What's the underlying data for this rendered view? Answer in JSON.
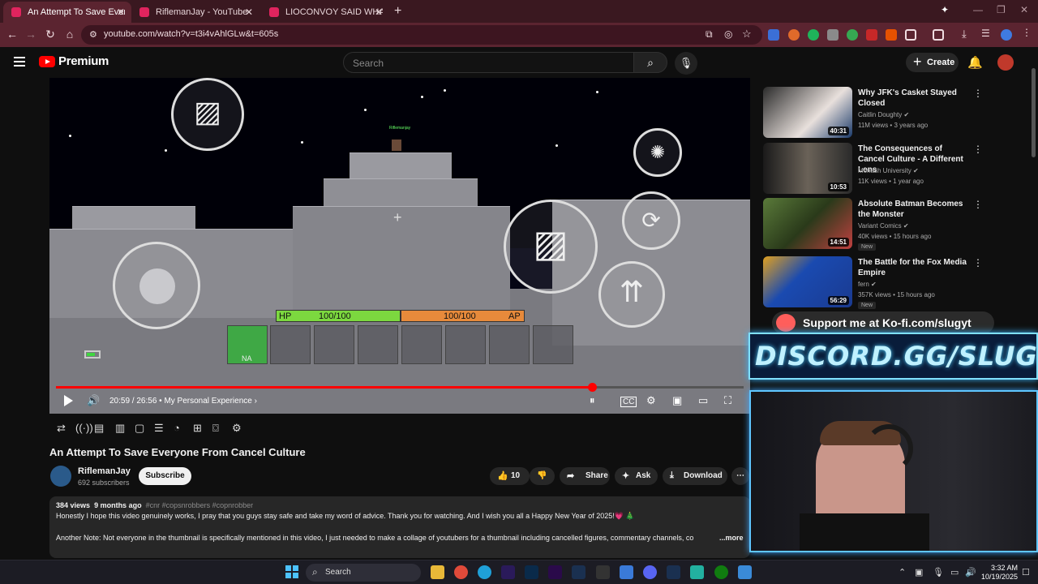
{
  "browser": {
    "tabs": [
      {
        "title": "An Attempt To Save Everyone F",
        "active": true
      },
      {
        "title": "RiflemanJay - YouTube",
        "active": false
      },
      {
        "title": "LIOCONVOY SAID WHAT?! | Rif",
        "active": false
      }
    ],
    "url": "youtube.com/watch?v=t3i4vAhlGLw&t=605s"
  },
  "header": {
    "logo_text": "Premium",
    "search_placeholder": "Search",
    "create_label": "Create"
  },
  "video": {
    "hud": {
      "hp_label": "HP",
      "hp_value": "100/100",
      "ap_value": "100/100",
      "ap_label": "AP",
      "slot_label": "NA",
      "player_name": "Riflemanjay"
    },
    "time": "20:59 / 26:56",
    "chapter": "My Personal Experience",
    "progress_fraction": 0.78,
    "accent_color": "#ff0000"
  },
  "title": "An Attempt To Save Everyone From Cancel Culture",
  "channel": {
    "name": "RiflemanJay",
    "subscribers": "692 subscribers",
    "subscribe_label": "Subscribe"
  },
  "actions": {
    "likes": "10",
    "share": "Share",
    "ask": "Ask",
    "download": "Download"
  },
  "description": {
    "views": "384 views",
    "age": "9 months ago",
    "tags": "#cnr #copsnrobbers #copnrobber",
    "line1": "Honestly I hope this video genuinely works, I pray that you guys stay safe and take my word of advice. Thank you for watching. And I wish you all a Happy New Year of 2025!💗 🎄",
    "line2": "Another Note: Not everyone in the thumbnail is specifically mentioned in this video, I just needed to make a collage of youtubers for a thumbnail including cancelled figures, commentary channels, co",
    "more": "...more"
  },
  "recommendations": [
    {
      "title": "Why JFK's Casket Stayed Closed",
      "channel": "Caitlin Doughty",
      "meta": "11M views • 3 years ago",
      "duration": "40:31",
      "new": ""
    },
    {
      "title": "The Consequences of Cancel Culture - A Different Lens",
      "channel": "Monash University",
      "meta": "11K views • 1 year ago",
      "duration": "10:53",
      "new": ""
    },
    {
      "title": "Absolute Batman Becomes the Monster",
      "channel": "Variant Comics",
      "meta": "40K views • 15 hours ago",
      "duration": "14:51",
      "new": "New"
    },
    {
      "title": "The Battle for the Fox Media Empire",
      "channel": "fern",
      "meta": "357K views • 15 hours ago",
      "duration": "56:29",
      "new": "New"
    }
  ],
  "overlay": {
    "kofi": "Support me at Ko-fi.com/slugyt",
    "discord": "DISCORD.GG/SLUG"
  },
  "taskbar": {
    "search": "Search",
    "time": "3:32 AM",
    "date": "10/19/2025"
  }
}
